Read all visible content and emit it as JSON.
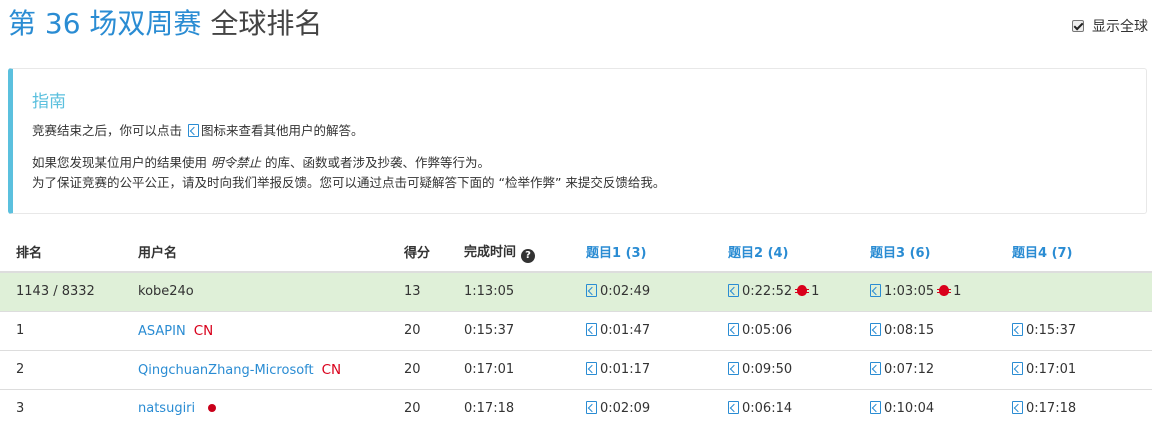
{
  "header": {
    "title_blue": "第 36 场双周赛",
    "title_grey": "全球排名",
    "global_toggle_label": "显示全球"
  },
  "guide": {
    "title": "指南",
    "line1_before": "竞赛结束之后，你可以点击",
    "line1_after": "图标来查看其他用户的解答。",
    "line2_before": "如果您发现某位用户的结果使用",
    "line2_em": "明令禁止",
    "line2_after": "的库、函数或者涉及抄袭、作弊等行为。",
    "line3": "为了保证竞赛的公平公正，请及时向我们举报反馈。您可以通过点击可疑解答下面的 “检举作弊” 来提交反馈给我。"
  },
  "table": {
    "headers": {
      "rank": "排名",
      "username": "用户名",
      "score": "得分",
      "finish_time": "完成时间",
      "q1": "题目1 (3)",
      "q2": "题目2 (4)",
      "q3": "题目3 (6)",
      "q4": "题目4 (7)"
    },
    "help_glyph": "?",
    "my_row": {
      "rank": "1143 / 8332",
      "username": "kobe24o",
      "score": "13",
      "finish_time": "1:13:05",
      "q1": "0:02:49",
      "q2": "0:22:52",
      "q2_bugs": "1",
      "q3": "1:03:05",
      "q3_bugs": "1",
      "q4": ""
    },
    "rows": [
      {
        "rank": "1",
        "username": "ASAPIN",
        "region": "CN",
        "score": "20",
        "finish_time": "0:15:37",
        "q1": "0:01:47",
        "q2": "0:05:06",
        "q3": "0:08:15",
        "q4": "0:15:37"
      },
      {
        "rank": "2",
        "username": "QingchuanZhang-Microsoft",
        "region": "CN",
        "score": "20",
        "finish_time": "0:17:01",
        "q1": "0:01:17",
        "q2": "0:09:50",
        "q3": "0:07:12",
        "q4": "0:17:01"
      },
      {
        "rank": "3",
        "username": "natsugiri",
        "score": "20",
        "finish_time": "0:17:18",
        "q1": "0:02:09",
        "q2": "0:06:14",
        "q3": "0:10:04",
        "q4": "0:17:18"
      }
    ]
  }
}
